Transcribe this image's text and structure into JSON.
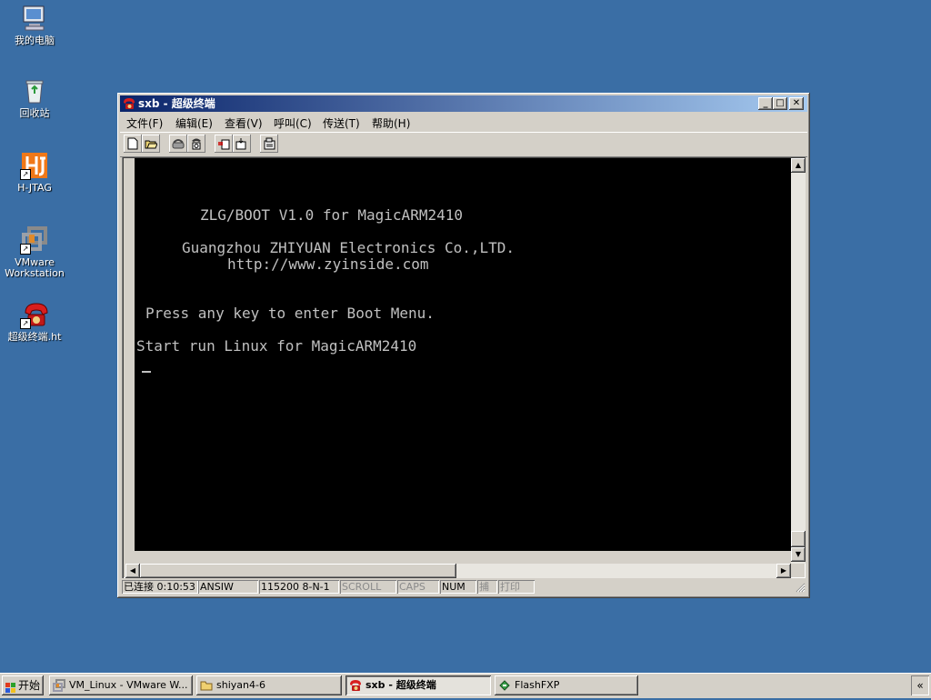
{
  "desktop": {
    "icons": [
      {
        "label": "我的电脑",
        "icon": "my-computer-icon"
      },
      {
        "label": "回收站",
        "icon": "recycle-bin-icon"
      },
      {
        "label": "H-JTAG",
        "icon": "hjtag-icon"
      },
      {
        "label_line1": "VMware",
        "label_line2": "Workstation",
        "icon": "vmware-icon"
      },
      {
        "label": "超级终端.ht",
        "icon": "hyperterminal-icon"
      }
    ]
  },
  "window": {
    "title": "sxb - 超级终端",
    "controls": {
      "minimize": "_",
      "maximize": "□",
      "close": "✕"
    },
    "menu": [
      "文件(F)",
      "编辑(E)",
      "查看(V)",
      "呼叫(C)",
      "传送(T)",
      "帮助(H)"
    ],
    "toolbar": [
      "new-icon",
      "open-icon",
      "disconnect-icon",
      "dial-icon",
      "send-icon",
      "receive-icon",
      "properties-icon"
    ],
    "terminal_lines": [
      "ZLG/BOOT V1.0 for MagicARM2410",
      "Guangzhou ZHIYUAN Electronics Co.,LTD.",
      "http://www.zyinside.com",
      "Press any key to enter Boot Menu.",
      "Start run Linux for MagicARM2410"
    ],
    "scroll_arrows": {
      "up": "▲",
      "down": "▼",
      "left": "◀",
      "right": "▶"
    },
    "status": {
      "connection": "已连接 0:10:53",
      "emulation": "ANSIW",
      "settings": "115200 8-N-1",
      "scroll": "SCROLL",
      "caps": "CAPS",
      "num": "NUM",
      "capture": "捕",
      "print": "打印"
    }
  },
  "taskbar": {
    "start_label": "开始",
    "tasks": [
      {
        "label": "VM_Linux - VMware W...",
        "icon": "vmware-icon",
        "active": false
      },
      {
        "label": "shiyan4-6",
        "icon": "folder-icon",
        "active": false
      },
      {
        "label": "sxb - 超级终端",
        "icon": "hyperterminal-icon",
        "active": true
      },
      {
        "label": "FlashFXP",
        "icon": "flashfxp-icon",
        "active": false
      }
    ],
    "tray_label": "«"
  },
  "colors": {
    "desktop": "#3a6ea5",
    "title_start": "#0a246a",
    "title_end": "#a6caf0",
    "terminal_bg": "#000000",
    "terminal_fg": "#c0c0c0"
  }
}
